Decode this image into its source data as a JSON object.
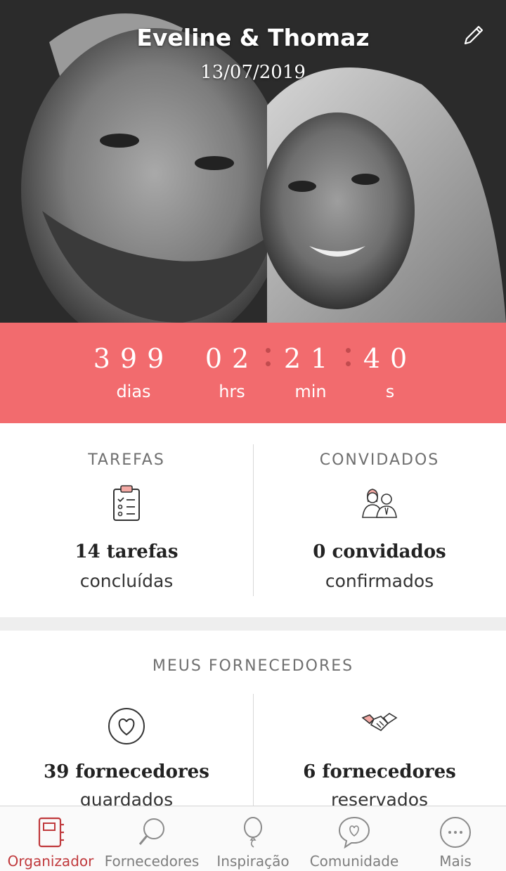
{
  "header": {
    "couple_names": "Eveline & Thomaz",
    "wedding_date": "13/07/2019",
    "edit_icon": "pencil-icon"
  },
  "countdown": {
    "days": {
      "value": "399",
      "label": "dias"
    },
    "hours": {
      "value": "02",
      "label": "hrs"
    },
    "minutes": {
      "value": "21",
      "label": "min"
    },
    "seconds": {
      "value": "40",
      "label": "s"
    }
  },
  "summary": {
    "tasks": {
      "title": "TAREFAS",
      "count": "14 tarefas",
      "sub": "concluídas",
      "icon": "clipboard-checklist-icon"
    },
    "guests": {
      "title": "CONVIDADOS",
      "count": "0 convidados",
      "sub": "confirmados",
      "icon": "couple-icon"
    }
  },
  "vendors": {
    "title": "MEUS FORNECEDORES",
    "saved": {
      "count": "39 fornecedores",
      "sub": "guardados",
      "icon": "heart-circle-icon"
    },
    "booked": {
      "count": "6 fornecedores",
      "sub": "reservados",
      "icon": "handshake-icon"
    }
  },
  "nav": {
    "items": [
      {
        "label": "Organizador",
        "icon": "notebook-icon",
        "active": true
      },
      {
        "label": "Fornecedores",
        "icon": "magnifier-icon",
        "active": false
      },
      {
        "label": "Inspiração",
        "icon": "balloon-icon",
        "active": false
      },
      {
        "label": "Comunidade",
        "icon": "chat-heart-icon",
        "active": false
      },
      {
        "label": "Mais",
        "icon": "more-dots-icon",
        "active": false
      }
    ]
  },
  "colors": {
    "accent": "#f26b6e",
    "active_nav": "#c0393c",
    "separator_dot": "#c24b4e"
  }
}
